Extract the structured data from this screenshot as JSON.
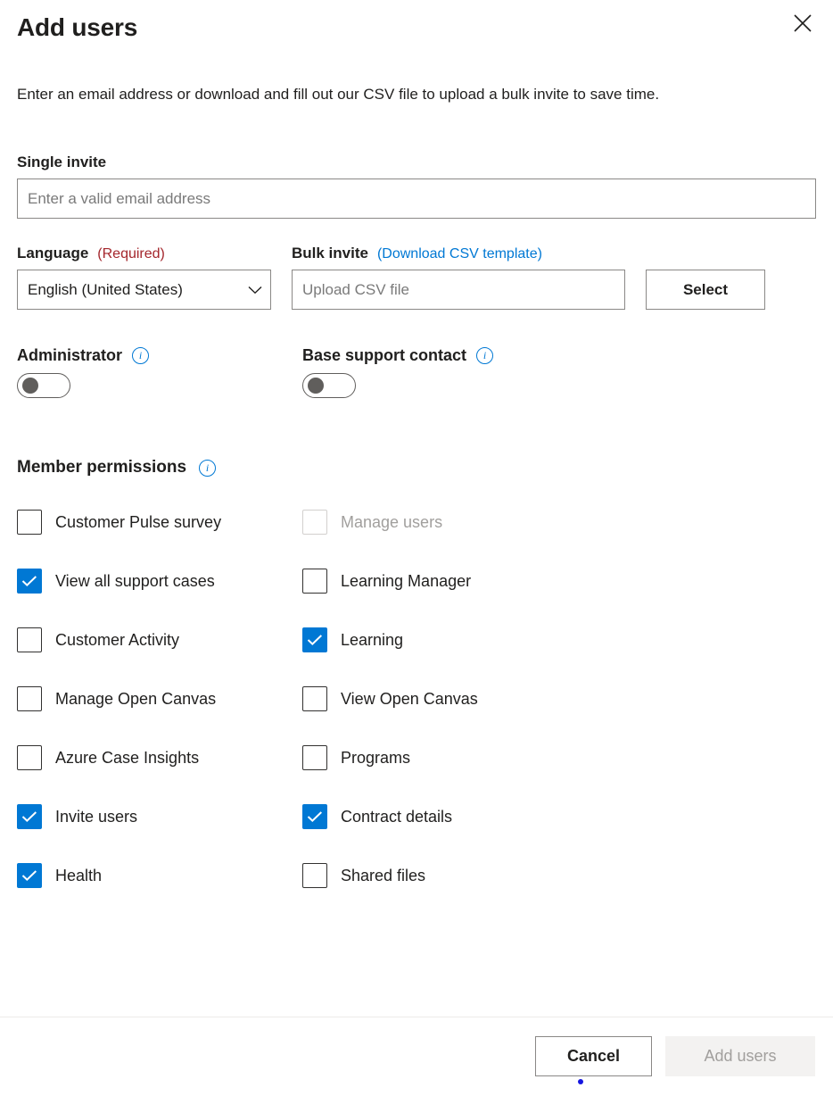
{
  "dialog": {
    "title": "Add users",
    "description": "Enter an email address or download and fill out our CSV file to upload a bulk invite to save time.",
    "close_icon": "close-icon"
  },
  "single_invite": {
    "label": "Single invite",
    "email_placeholder": "Enter a valid email address",
    "email_value": ""
  },
  "language": {
    "label": "Language",
    "required_tag": "(Required)",
    "selected": "English (United States)",
    "chevron_icon": "chevron-down-icon"
  },
  "bulk_invite": {
    "label": "Bulk invite",
    "download_link": "(Download CSV template)",
    "upload_placeholder": "Upload CSV file",
    "upload_value": "",
    "select_button": "Select"
  },
  "toggles": [
    {
      "label": "Administrator",
      "info_icon": "info-icon",
      "state": "off"
    },
    {
      "label": "Base support contact",
      "info_icon": "info-icon",
      "state": "off"
    }
  ],
  "permissions": {
    "title": "Member permissions",
    "info_icon": "info-icon",
    "left_column": [
      {
        "label": "Customer Pulse survey",
        "checked": false,
        "disabled": false
      },
      {
        "label": "View all support cases",
        "checked": true,
        "disabled": false
      },
      {
        "label": "Customer Activity",
        "checked": false,
        "disabled": false
      },
      {
        "label": "Manage Open Canvas",
        "checked": false,
        "disabled": false
      },
      {
        "label": "Azure Case Insights",
        "checked": false,
        "disabled": false
      },
      {
        "label": "Invite users",
        "checked": true,
        "disabled": false
      },
      {
        "label": "Health",
        "checked": true,
        "disabled": false
      }
    ],
    "right_column": [
      {
        "label": "Manage users",
        "checked": false,
        "disabled": true
      },
      {
        "label": "Learning Manager",
        "checked": false,
        "disabled": false
      },
      {
        "label": "Learning",
        "checked": true,
        "disabled": false
      },
      {
        "label": "View Open Canvas",
        "checked": false,
        "disabled": false
      },
      {
        "label": "Programs",
        "checked": false,
        "disabled": false
      },
      {
        "label": "Contract details",
        "checked": true,
        "disabled": false
      },
      {
        "label": "Shared files",
        "checked": false,
        "disabled": false
      }
    ]
  },
  "footer": {
    "cancel_label": "Cancel",
    "submit_label": "Add users",
    "submit_disabled": true
  },
  "colors": {
    "accent": "#0078d4",
    "required": "#a4262c",
    "text": "#201f1e",
    "disabled_text": "#a19f9d",
    "border": "#8a8886",
    "divider": "#edebe9",
    "cursor_marker": "#1515e0"
  }
}
